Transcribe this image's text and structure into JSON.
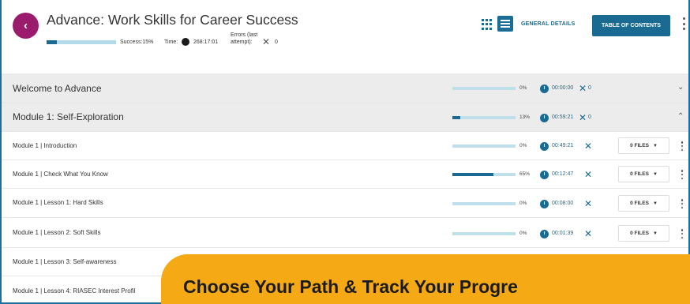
{
  "course": {
    "title": "Advance: Work Skills for Career Success",
    "back_icon": "‹",
    "progress_fraction": 0.15,
    "success_text": "Success:15%",
    "time_label": "Time:",
    "time_value": "268:17:01",
    "errors_label": "Errors (last attempt):",
    "errors_count": "0"
  },
  "toolbar": {
    "general_details": "GENERAL DETAILS",
    "table_of_contents": "TABLE OF CONTENTS"
  },
  "sections": [
    {
      "name": "Welcome to Advance",
      "percent": "0%",
      "progress": 0,
      "time": "00:00:00",
      "errors": "0",
      "chevron": "⌄"
    },
    {
      "name": "Module 1: Self-Exploration",
      "percent": "13%",
      "progress": 0.13,
      "time": "00:59:21",
      "errors": "0",
      "chevron": "⌃"
    }
  ],
  "lessons": [
    {
      "name": "Module 1 | Introduction",
      "percent": "0%",
      "progress": 0,
      "time": "00:49:21",
      "files": "0 FILES"
    },
    {
      "name": "Module 1 | Check What You Know",
      "percent": "65%",
      "progress": 0.65,
      "time": "00:12:47",
      "files": "0 FILES"
    },
    {
      "name": "Module 1 | Lesson 1: Hard Skills",
      "percent": "0%",
      "progress": 0,
      "time": "00:08:00",
      "files": "0 FILES"
    },
    {
      "name": "Module 1 | Lesson 2: Soft Skills",
      "percent": "0%",
      "progress": 0,
      "time": "00:01:39",
      "files": "0 FILES"
    },
    {
      "name": "Module 1 | Lesson 3: Self-awareness"
    },
    {
      "name": "Module 1 | Lesson 4: RIASEC Interest Profil"
    }
  ],
  "promo": {
    "text": "Choose Your Path & Track Your Progre"
  },
  "colors": {
    "accent": "#1b6a91",
    "back_button": "#9b1b6d",
    "progress_track": "#bfdfea",
    "banner": "#f5a915"
  }
}
